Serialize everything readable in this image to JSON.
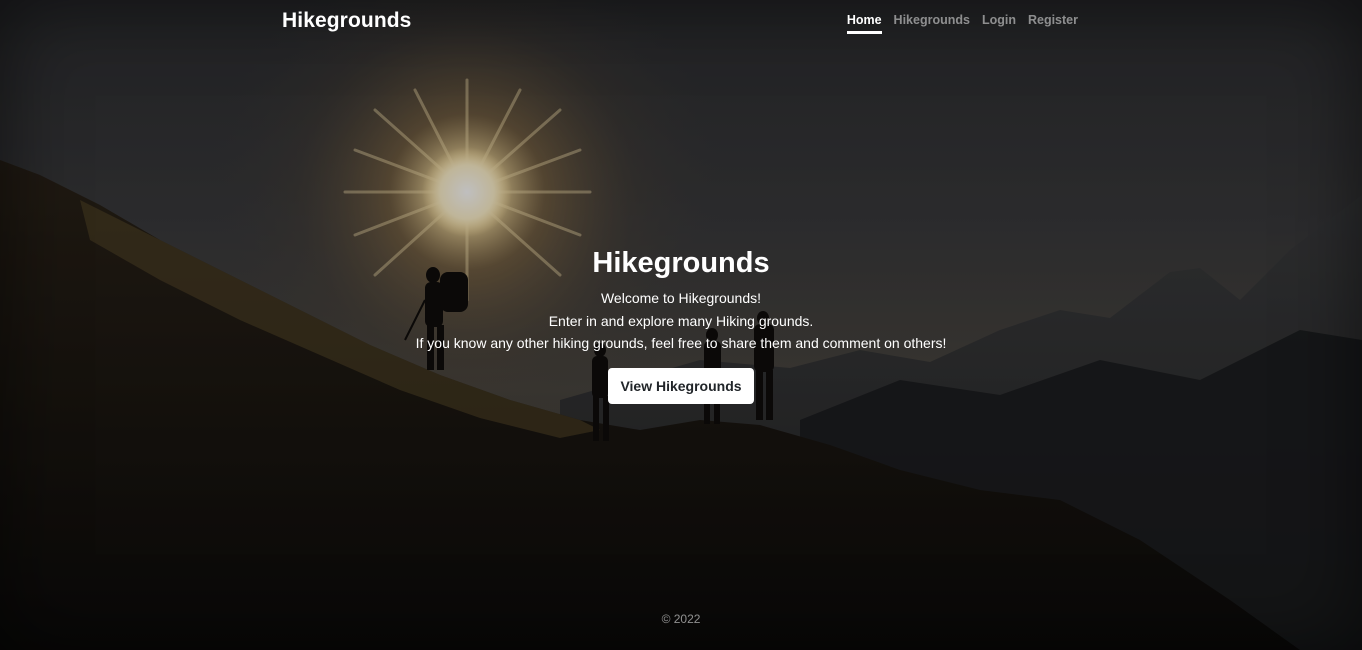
{
  "nav": {
    "brand": "Hikegrounds",
    "links": [
      {
        "label": "Home",
        "active": true
      },
      {
        "label": "Hikegrounds",
        "active": false
      },
      {
        "label": "Login",
        "active": false
      },
      {
        "label": "Register",
        "active": false
      }
    ]
  },
  "hero": {
    "title": "Hikegrounds",
    "lines": [
      "Welcome to Hikegrounds!",
      "Enter in and explore many Hiking grounds.",
      "If you know any other hiking grounds, feel free to share them and comment on others!"
    ],
    "button_label": "View Hikegrounds"
  },
  "footer": {
    "text": "© 2022"
  },
  "colors": {
    "nav_active": "#ffffff",
    "nav_inactive": "#8a8a8a",
    "button_bg": "#ffffff",
    "button_text": "#212529"
  }
}
